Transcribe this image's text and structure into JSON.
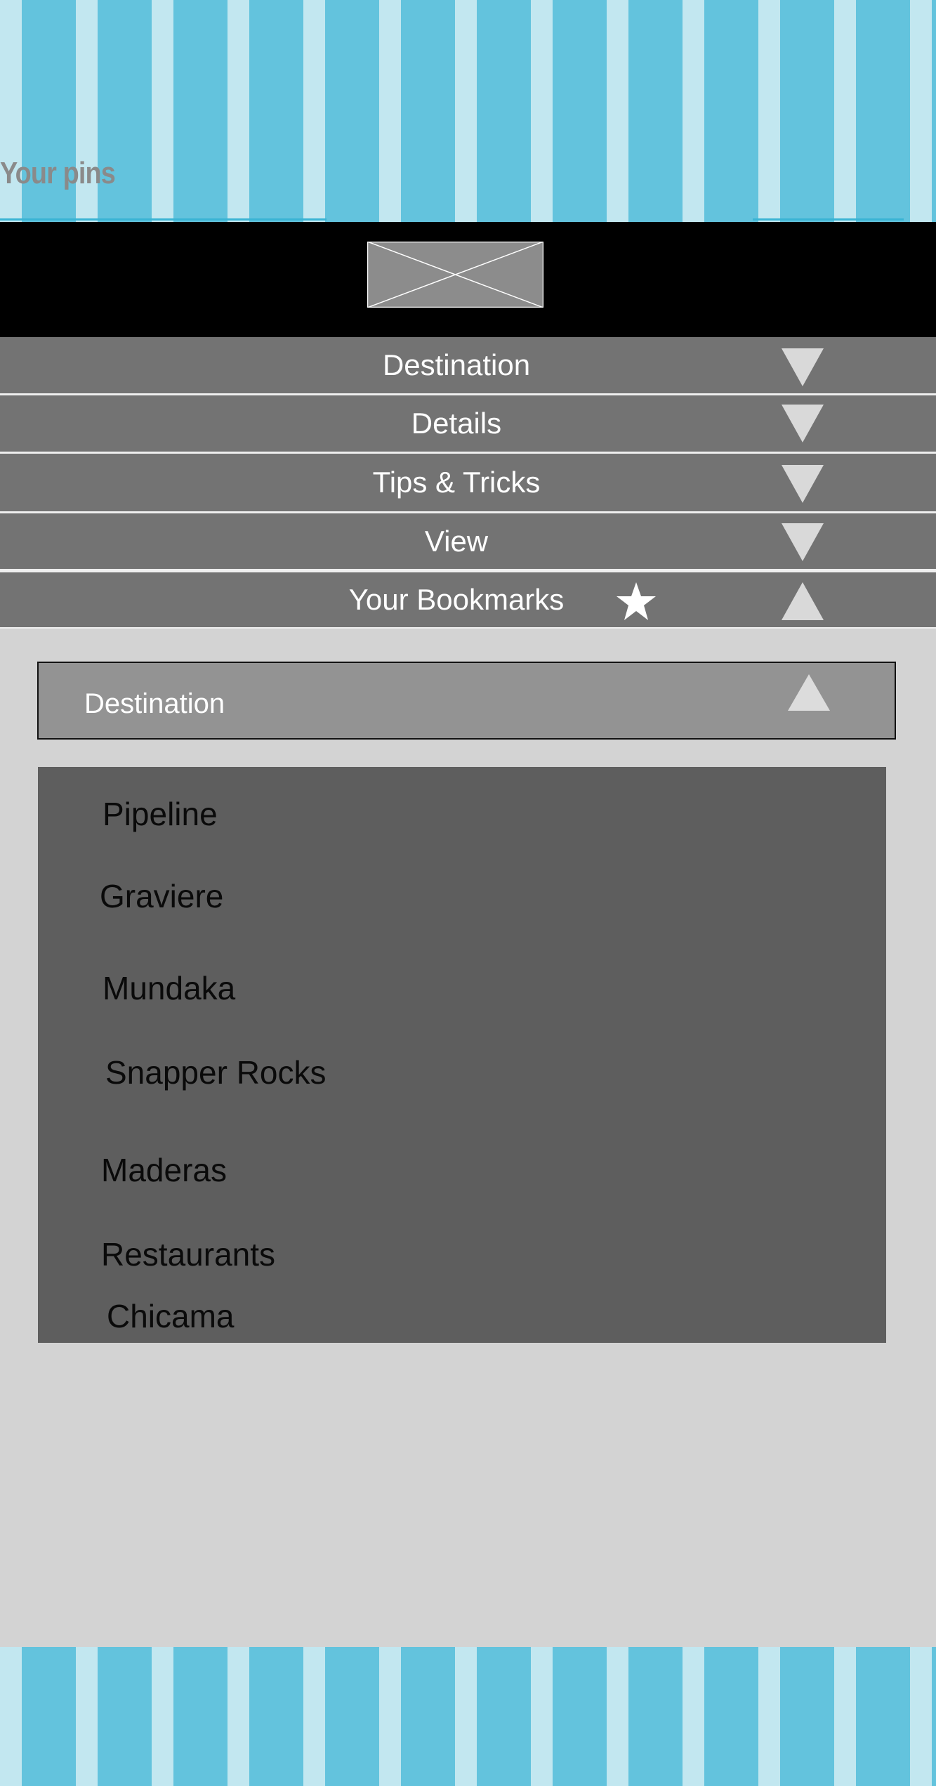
{
  "header": {
    "title": "Your pins",
    "logo_icon": "image-placeholder-icon"
  },
  "menu": {
    "items": [
      {
        "label": "Destination",
        "icon": "chevron-down-icon"
      },
      {
        "label": "Details",
        "icon": "chevron-down-icon"
      },
      {
        "label": "Tips & Tricks",
        "icon": "chevron-down-icon"
      },
      {
        "label": "View",
        "icon": "chevron-down-icon"
      },
      {
        "label": "Your Bookmarks",
        "icon": "chevron-up-icon",
        "badge_icon": "star-icon"
      }
    ]
  },
  "bookmarks": {
    "section_label": "Destination",
    "section_icon": "chevron-up-icon",
    "list": [
      "Pipeline",
      "Graviere",
      "Mundaka",
      "Snapper Rocks",
      "Maderas",
      "Restaurants",
      "Chicama"
    ]
  },
  "colors": {
    "stripe_light": "#c2e7f0",
    "stripe_dark": "#63c3dd",
    "menu_bg": "#737373",
    "panel_bg": "#5e5e5e",
    "page_bg": "#d3d3d3"
  }
}
